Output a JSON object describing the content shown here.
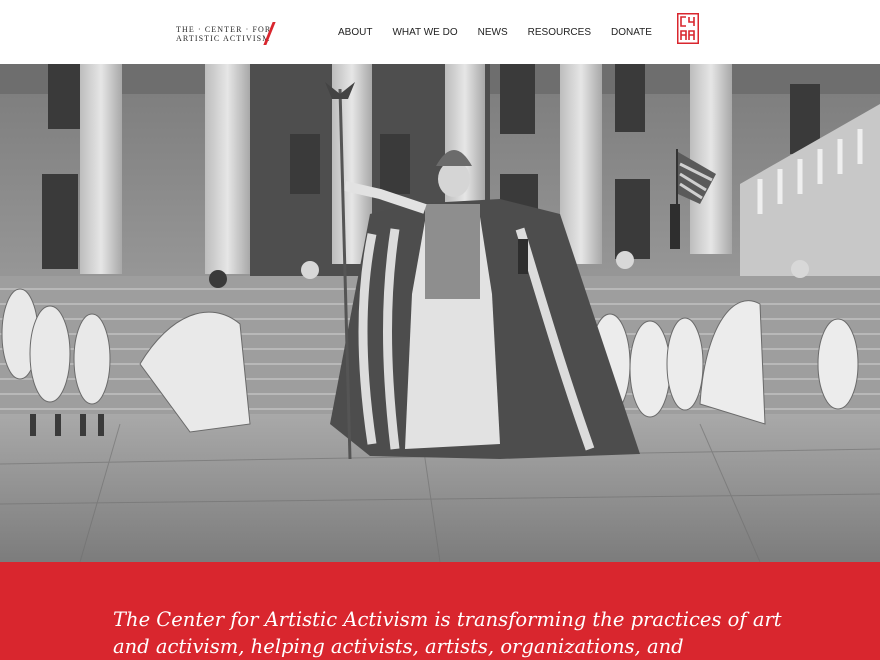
{
  "brand": {
    "line1": "THE · CENTER · FOR",
    "line2": "ARTISTIC ACTIVISM",
    "accent_color": "#d9262e"
  },
  "nav": {
    "items": [
      "ABOUT",
      "WHAT WE DO",
      "NEWS",
      "RESOURCES",
      "DONATE"
    ]
  },
  "logo": {
    "icon": "c4aa-logo-icon",
    "letters": "C4AA"
  },
  "hero": {
    "image_icon": "historic-photo"
  },
  "mission": {
    "text": "The Center for Artistic Activism is transforming the practices of art and activism, helping activists, artists, organizations, and"
  }
}
